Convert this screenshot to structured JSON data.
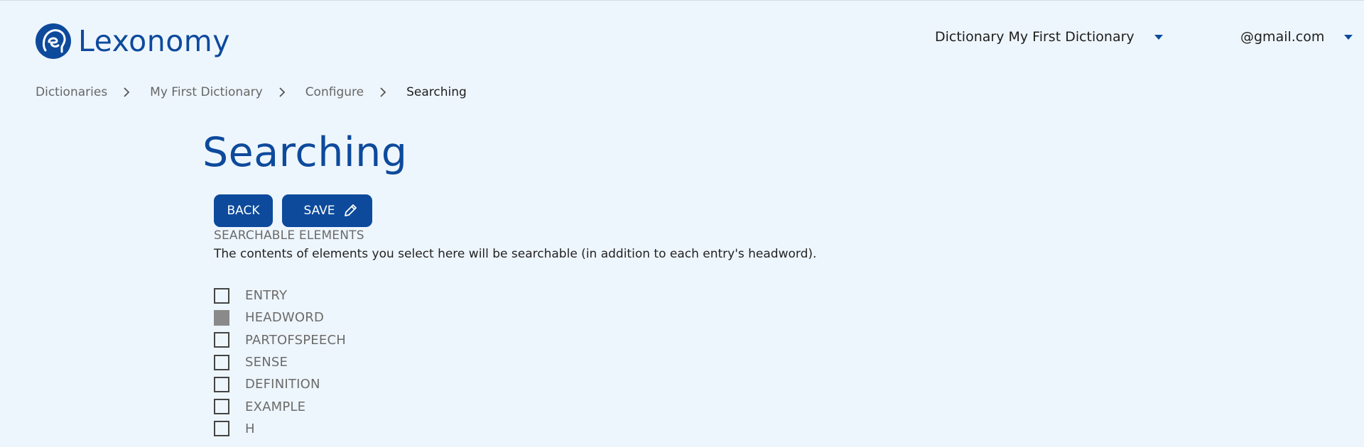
{
  "app": {
    "logo_text": "Lexonomy"
  },
  "header": {
    "dictionary_selector_label": "Dictionary My First Dictionary",
    "user_email": "@gmail.com"
  },
  "breadcrumb": [
    {
      "label": "Dictionaries"
    },
    {
      "label": "My First Dictionary"
    },
    {
      "label": "Configure"
    },
    {
      "label": "Searching"
    }
  ],
  "page": {
    "title": "Searching",
    "back_label": "BACK",
    "save_label": "SAVE",
    "section_heading": "SEARCHABLE ELEMENTS",
    "section_description": "The contents of elements you select here will be searchable (in addition to each entry's headword)."
  },
  "elements": [
    {
      "label": "ENTRY",
      "checked": false
    },
    {
      "label": "HEADWORD",
      "checked": true
    },
    {
      "label": "PARTOFSPEECH",
      "checked": false
    },
    {
      "label": "SENSE",
      "checked": false
    },
    {
      "label": "DEFINITION",
      "checked": false
    },
    {
      "label": "EXAMPLE",
      "checked": false
    },
    {
      "label": "H",
      "checked": false
    }
  ],
  "colors": {
    "brand": "#0d4a9c",
    "background": "#eef6fd",
    "checked_box": "#8a8a8a"
  },
  "icons": {
    "logo": "lexonomy-head-icon",
    "caret": "caret-down-icon",
    "breadcrumb_separator": "chevron-right-icon",
    "save": "pencil-icon"
  }
}
